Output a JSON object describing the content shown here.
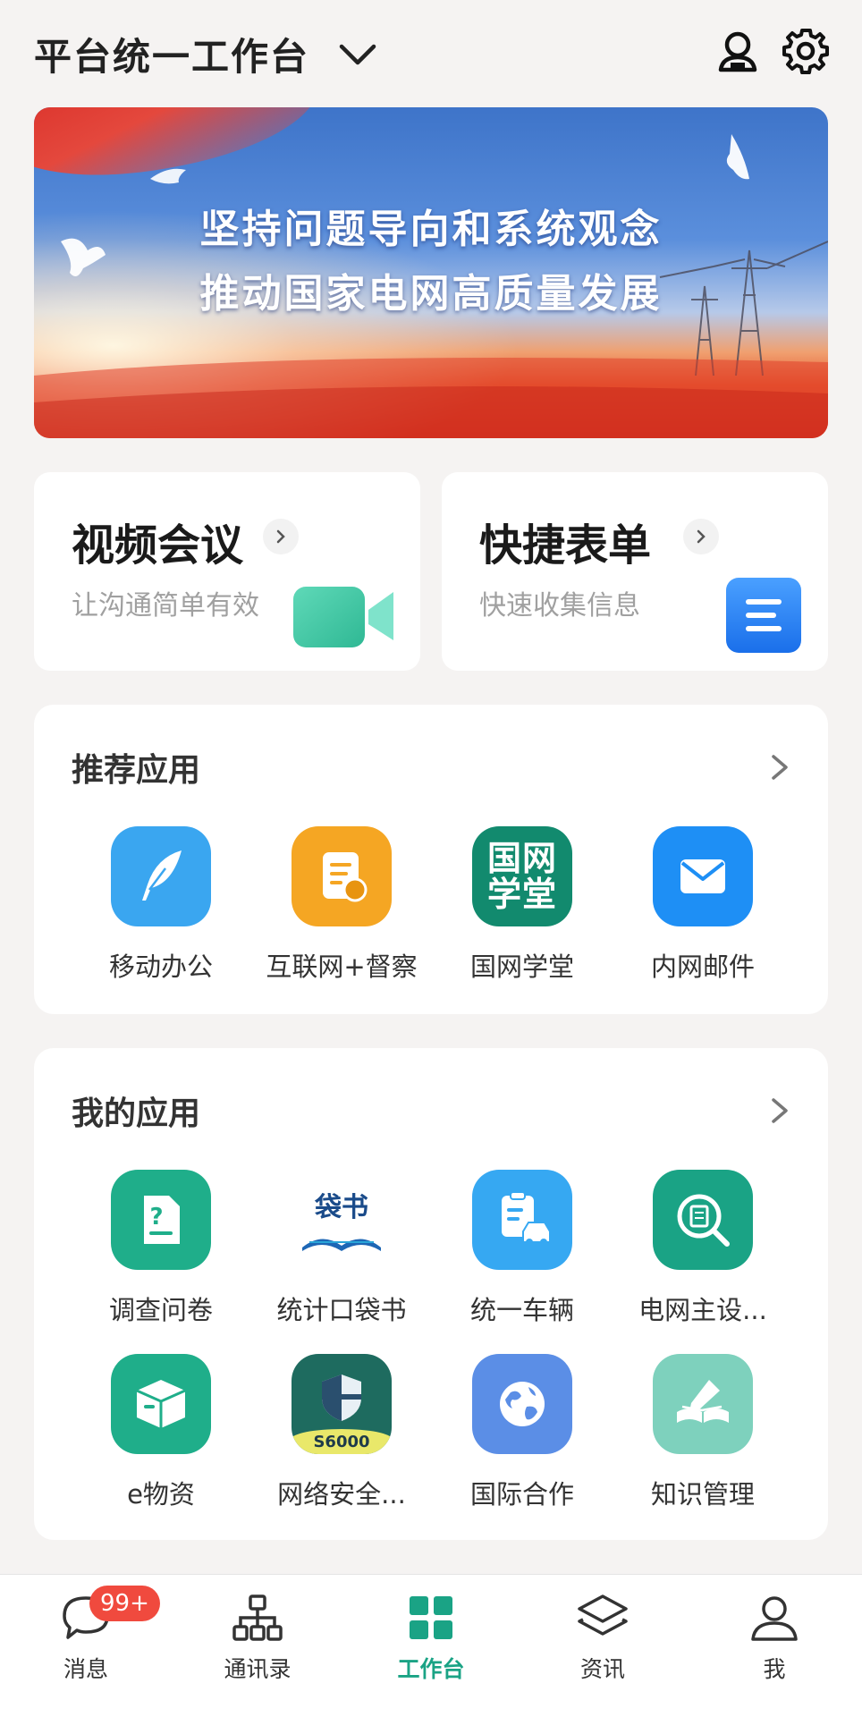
{
  "header": {
    "title": "平台统一工作台"
  },
  "banner": {
    "line1": "坚持问题导向和系统观念",
    "line2": "推动国家电网高质量发展"
  },
  "quick_cards": [
    {
      "title": "视频会议",
      "subtitle": "让沟通简单有效",
      "icon": "video-camera-icon"
    },
    {
      "title": "快捷表单",
      "subtitle": "快速收集信息",
      "icon": "form-list-icon"
    }
  ],
  "recommended": {
    "title": "推荐应用",
    "apps": [
      {
        "label": "移动办公",
        "icon": "feather-icon",
        "color": "#3aa6f0"
      },
      {
        "label": "互联网+督察",
        "icon": "document-badge-icon",
        "color": "#f5a623"
      },
      {
        "label": "国网学堂",
        "icon": "guowang-xuetang-logo",
        "logo_text_top": "国网",
        "logo_text_bottom": "学堂",
        "color": "#128a6e"
      },
      {
        "label": "内网邮件",
        "icon": "mail-icon",
        "color": "#1e8ff5"
      }
    ]
  },
  "my_apps": {
    "title": "我的应用",
    "apps": [
      {
        "label": "调查问卷",
        "icon": "question-doc-icon",
        "color": "#1fae8a"
      },
      {
        "label": "统计口袋书",
        "icon": "pocket-book-logo",
        "logo_text": "袋书",
        "color": "#ffffff"
      },
      {
        "label": "统一车辆",
        "icon": "car-clipboard-icon",
        "color": "#36a8f2"
      },
      {
        "label": "电网主设...",
        "icon": "search-doc-icon",
        "color": "#1aa385"
      },
      {
        "label": "e物资",
        "icon": "box-icon",
        "color": "#1fae8a"
      },
      {
        "label": "网络安全...",
        "icon": "shield-logo",
        "logo_text": "S6000",
        "color": "#1e6b5f"
      },
      {
        "label": "国际合作",
        "icon": "globe-icon",
        "color": "#5b8ee6"
      },
      {
        "label": "知识管理",
        "icon": "book-pen-icon",
        "color": "#7ed1bd"
      }
    ]
  },
  "tabbar": {
    "tabs": [
      {
        "label": "消息",
        "icon": "chat-bubble-icon",
        "badge": "99+"
      },
      {
        "label": "通讯录",
        "icon": "org-chart-icon"
      },
      {
        "label": "工作台",
        "icon": "grid-icon",
        "active": true
      },
      {
        "label": "资讯",
        "icon": "layers-icon"
      },
      {
        "label": "我",
        "icon": "person-icon"
      }
    ],
    "active_color": "#1aa385",
    "badge_color": "#f04a3e"
  }
}
